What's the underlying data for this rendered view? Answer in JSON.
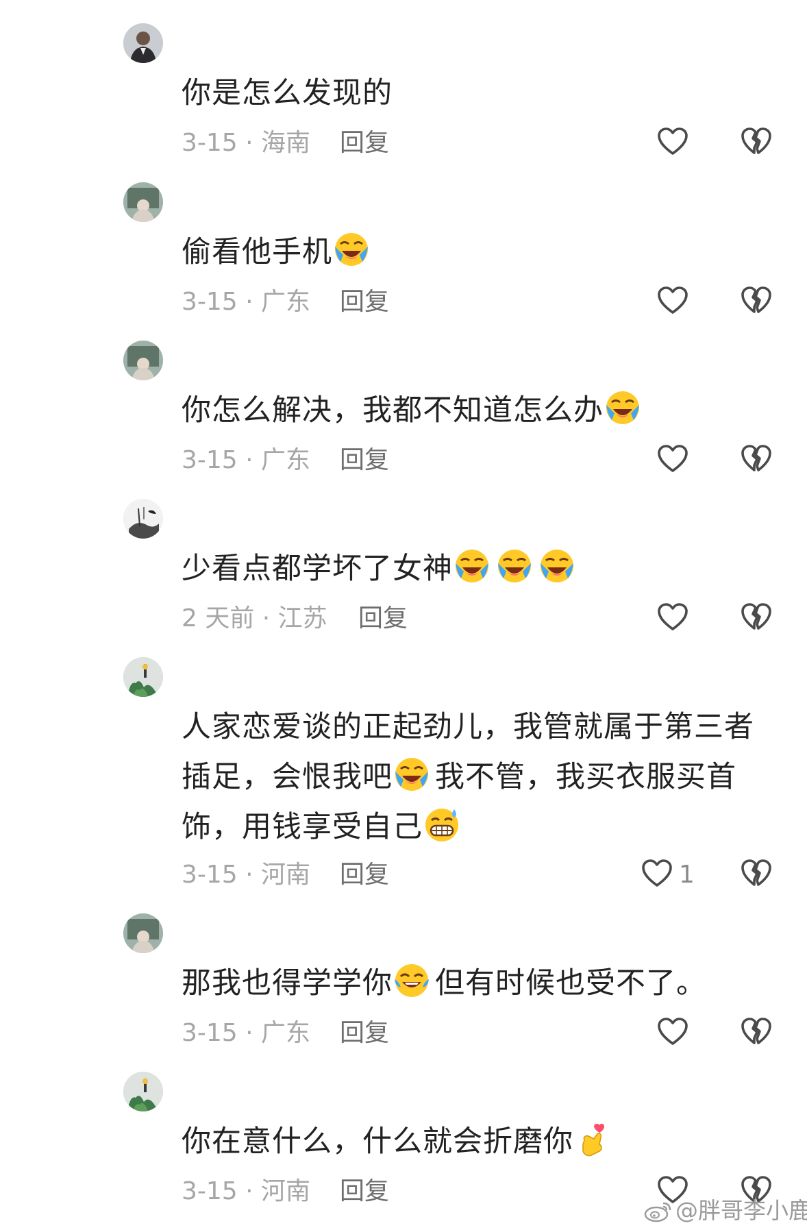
{
  "comments": [
    {
      "text": "你是怎么发现的",
      "text2": "",
      "text3": "",
      "emoji_count": 0,
      "time_location": "3-15 · 海南",
      "reply": "回复",
      "likes": ""
    },
    {
      "text": "偷看他手机",
      "text2": "",
      "text3": "",
      "emoji_count": 1,
      "time_location": "3-15 · 广东",
      "reply": "回复",
      "likes": ""
    },
    {
      "text": "你怎么解决，我都不知道怎么办",
      "text2": "",
      "text3": "",
      "emoji_count": 1,
      "time_location": "3-15 · 广东",
      "reply": "回复",
      "likes": ""
    },
    {
      "text": "少看点都学坏了女神",
      "text2": "",
      "text3": "",
      "emoji_count": 3,
      "time_location": "2 天前 · 江苏",
      "reply": "回复",
      "likes": ""
    },
    {
      "text": "人家恋爱谈的正起劲儿，我管就属于第三者插足，会恨我吧",
      "text2": "我不管，我买衣服买首饰，用钱享受自己",
      "text3": "",
      "emoji_count": 1,
      "time_location": "3-15 · 河南",
      "reply": "回复",
      "likes": "1"
    },
    {
      "text": "那我也得学学你",
      "text2": "但有时候也受不了。",
      "text3": "",
      "emoji_count": 1,
      "time_location": "3-15 · 广东",
      "reply": "回复",
      "likes": ""
    },
    {
      "text": "你在意什么，什么就会折磨你",
      "text2": "",
      "text3": "",
      "emoji_count": 1,
      "time_location": "3-15 · 河南",
      "reply": "回复",
      "likes": ""
    }
  ],
  "watermark": "@胖哥李小鹿",
  "icons": {
    "like": "heart-outline-icon",
    "dislike": "broken-heart-icon",
    "emoji_cry_laugh": "loudly-crying-face-icon",
    "emoji_grin_sweat": "grinning-sweat-face-icon",
    "emoji_tears_joy": "face-with-tears-of-joy-icon",
    "emoji_finger_heart": "finger-heart-icon",
    "watermark_logo": "weibo-logo-icon"
  },
  "colors": {
    "text": "#222222",
    "meta": "#a6a6a6",
    "reply": "#6e6e6e",
    "icon": "#555555"
  }
}
